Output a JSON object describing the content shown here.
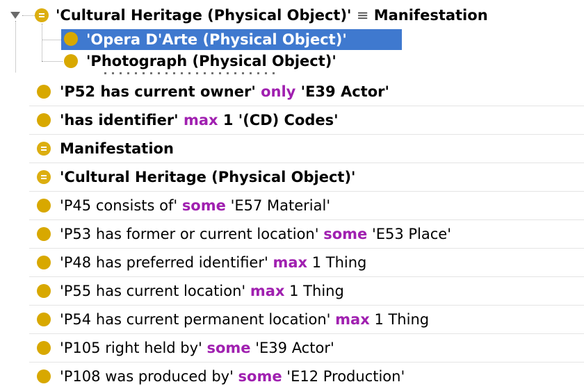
{
  "hierarchy": {
    "root": {
      "label": "'Cultural Heritage (Physical Object)'",
      "equiv_symbol": "≡",
      "equiv_label": "Manifestation",
      "icon": "equivalent-class-icon"
    },
    "children": [
      {
        "label": "'Opera D'Arte (Physical Object)'",
        "selected": true,
        "icon": "class-icon"
      },
      {
        "label": "'Photograph (Physical Object)'",
        "selected": false,
        "icon": "class-icon"
      }
    ]
  },
  "description": {
    "rows": [
      {
        "parts": [
          "'P52 has current owner'",
          "only",
          "'E39 Actor'"
        ],
        "bold": true,
        "icon": "class-icon"
      },
      {
        "parts": [
          "'has identifier'",
          "max",
          "1 '(CD) Codes'"
        ],
        "bold": true,
        "icon": "class-icon"
      },
      {
        "parts": [
          "Manifestation"
        ],
        "bold": true,
        "icon": "equivalent-class-icon"
      },
      {
        "parts": [
          "'Cultural Heritage (Physical Object)'"
        ],
        "bold": true,
        "icon": "equivalent-class-icon"
      },
      {
        "parts": [
          "'P45 consists of'",
          "some",
          "'E57 Material'"
        ],
        "bold": false,
        "icon": "class-icon"
      },
      {
        "parts": [
          "'P53 has former or current location'",
          "some",
          "'E53 Place'"
        ],
        "bold": false,
        "icon": "class-icon"
      },
      {
        "parts": [
          "'P48 has preferred identifier'",
          "max",
          "1 Thing"
        ],
        "bold": false,
        "icon": "class-icon"
      },
      {
        "parts": [
          "'P55 has current location'",
          "max",
          "1 Thing"
        ],
        "bold": false,
        "icon": "class-icon"
      },
      {
        "parts": [
          "'P54 has current permanent location'",
          "max",
          "1 Thing"
        ],
        "bold": false,
        "icon": "class-icon"
      },
      {
        "parts": [
          "'P105 right held by'",
          "some",
          "'E39 Actor'"
        ],
        "bold": false,
        "icon": "class-icon"
      },
      {
        "parts": [
          "'P108 was produced by'",
          "some",
          "'E12 Production'"
        ],
        "bold": false,
        "icon": "class-icon"
      }
    ]
  },
  "colors": {
    "selection": "#3f79cf",
    "keyword": "#a020b0",
    "class_icon": "#d8a800"
  }
}
